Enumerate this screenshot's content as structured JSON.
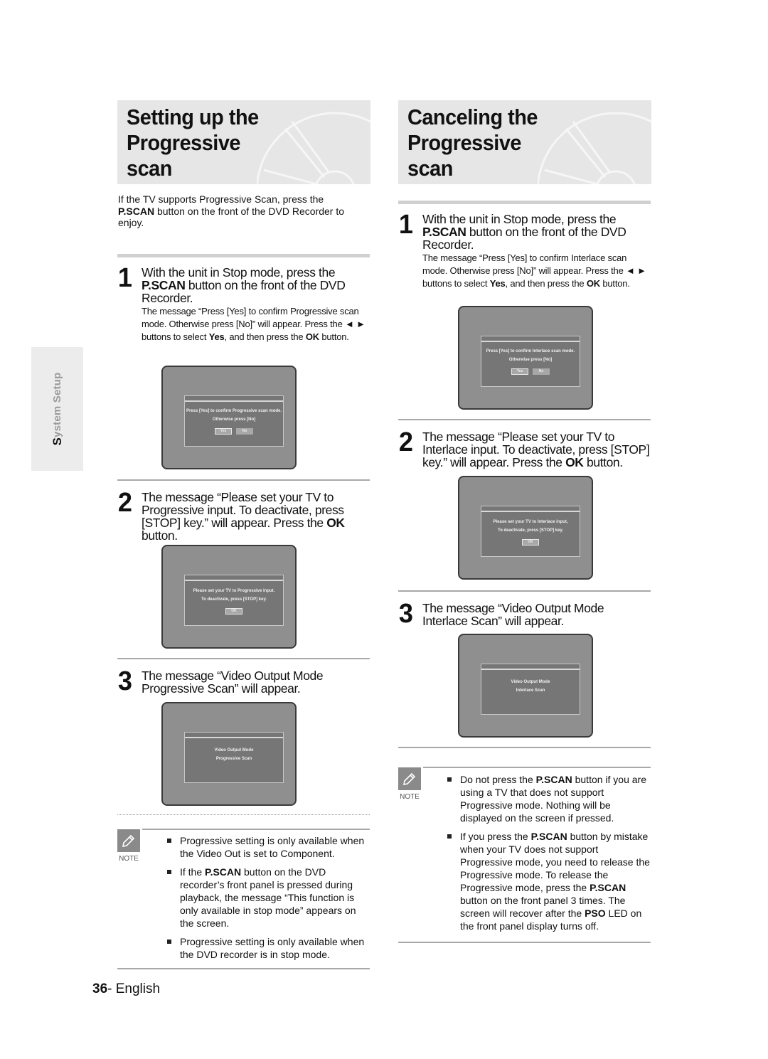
{
  "side_tab": {
    "first_letter": "S",
    "rest": "ystem Setup"
  },
  "left": {
    "title_line1": "Setting up the Progressive",
    "title_line2": "scan",
    "intro_bold": "P.SCAN",
    "intro_pre": "If the TV supports Progressive Scan, press the",
    "intro_post": " button on the front of the DVD Recorder to enjoy.",
    "steps": [
      {
        "number": "1",
        "lead_pre": "With the unit in Stop mode, press the",
        "lead_bold": "P.SCAN",
        "lead_post": " button on the front of the DVD Recorder.",
        "sub_pre": "The message “Press [Yes] to confirm Progressive scan mode. Otherwise press [No]” will appear. Press the ◄ ► buttons to select ",
        "sub_bold1": "Yes",
        "sub_mid": ", and then press the ",
        "sub_bold2": "OK",
        "sub_post": " button.",
        "screen": {
          "line1": "Press [Yes] to confirm Progressive scan mode.",
          "line2": "Otherwise press [No]",
          "btn_yes": "Yes",
          "btn_no": "No"
        }
      },
      {
        "number": "2",
        "lead_pre": "The message “Please set your TV to Progressive input. To deactivate, press [STOP] key.” will appear. Press the ",
        "lead_bold": "OK",
        "lead_post": " button.",
        "screen": {
          "line1": "Please set your TV to Progressive input.",
          "line2": "To deactivate, press [STOP] key.",
          "btn_ok": "OK"
        }
      },
      {
        "number": "3",
        "lead": "The message “Video Output Mode Progressive Scan” will appear.",
        "screen": {
          "line1": "Video Output Mode",
          "line2": "Progressive Scan"
        }
      }
    ],
    "note": {
      "label": "NOTE",
      "items": [
        {
          "pre": "Progressive setting is only available when the Video Out is set to Component.",
          "bold": "",
          "post": ""
        },
        {
          "pre": "If the ",
          "bold": "P.SCAN",
          "post": " button on the DVD recorder’s front panel is pressed during playback, the message “This function is only available in stop mode” appears on the screen."
        },
        {
          "pre": "Progressive setting is only available when the DVD recorder is in stop mode.",
          "bold": "",
          "post": ""
        }
      ]
    }
  },
  "right": {
    "title_line1": "Canceling the Progressive",
    "title_line2": "scan",
    "steps": [
      {
        "number": "1",
        "lead_pre": "With the unit in Stop mode, press the",
        "lead_bold": "P.SCAN",
        "lead_post": " button on the front of the DVD Recorder.",
        "sub_pre": "The message “Press [Yes] to confirm Interlace scan mode. Otherwise press [No]” will appear. Press the ◄ ► buttons to select ",
        "sub_bold1": "Yes",
        "sub_mid": ", and then press the ",
        "sub_bold2": "OK",
        "sub_post": " button.",
        "screen": {
          "line1": "Press [Yes] to confirm Interlace scan mode.",
          "line2": "Otherwise press [No]",
          "btn_yes": "Yes",
          "btn_no": "No"
        }
      },
      {
        "number": "2",
        "lead_pre": "The message “Please set your TV to Interlace input. To deactivate, press [STOP] key.” will appear. Press the ",
        "lead_bold": "OK",
        "lead_post": " button.",
        "screen": {
          "line1": "Please set your TV to Interlace input,",
          "line2": "To deactivate, press [STOP] key.",
          "btn_ok": "OK"
        }
      },
      {
        "number": "3",
        "lead": "The message “Video Output Mode Interlace Scan” will appear.",
        "screen": {
          "line1": "Video Output Mode",
          "line2": "Interlace Scan"
        }
      }
    ],
    "note": {
      "label": "NOTE",
      "items": [
        {
          "pre": "Do not press the ",
          "bold": "P.SCAN",
          "post": " button if you are using a TV that does not support Progressive mode. Nothing will be displayed on the screen if pressed."
        },
        {
          "pre": "If you press the ",
          "bold": "P.SCAN",
          "post": " button by mistake when your TV does not support Progressive mode, you need to release the Progressive mode. To release the Progressive mode, press the ",
          "bold2": "P.SCAN",
          "post2": " button on the front panel 3 times. The screen will recover after the ",
          "bold3": "PSO",
          "post3": " LED on the front panel display turns off."
        }
      ]
    }
  },
  "footer": {
    "page_number": "36",
    "separator": "-",
    "language": " English"
  }
}
